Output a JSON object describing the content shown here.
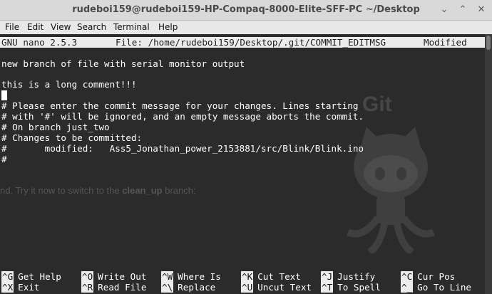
{
  "window": {
    "title": "rudeboi159@rudeboi159-HP-Compaq-8000-Elite-SFF-PC ~/Desktop",
    "controls": [
      "minimize-icon",
      "maximize-icon",
      "close-icon"
    ]
  },
  "menubar": {
    "items": [
      "File",
      "Edit",
      "View",
      "Search",
      "Terminal",
      "Help"
    ]
  },
  "nano": {
    "version": "GNU nano 2.5.3",
    "file": "File: /home/rudeboi159/Desktop/.git/COMMIT_EDITMSG",
    "status": "Modified"
  },
  "editor": {
    "lines": [
      "new branch of file with serial monitor output",
      "",
      "this is a long comment!!!",
      "",
      "# Please enter the commit message for your changes. Lines starting",
      "# with '#' will be ignored, and an empty message aborts the commit.",
      "# On branch just_two",
      "# Changes to be committed:",
      "#       modified:   Ass5_Jonathan_power_2153881/src/Blink/Blink.ino",
      "#"
    ]
  },
  "background": {
    "git_text": "Git",
    "note_prefix": "nd. Try it now to switch to the ",
    "note_bold": "clean_up",
    "note_suffix": " branch:"
  },
  "shortcuts": {
    "row1": [
      {
        "key": "^G",
        "label": "Get Help"
      },
      {
        "key": "^O",
        "label": "Write Out"
      },
      {
        "key": "^W",
        "label": "Where Is"
      },
      {
        "key": "^K",
        "label": "Cut Text"
      },
      {
        "key": "^J",
        "label": "Justify"
      },
      {
        "key": "^C",
        "label": "Cur Pos"
      }
    ],
    "row2": [
      {
        "key": "^X",
        "label": "Exit"
      },
      {
        "key": "^R",
        "label": "Read File"
      },
      {
        "key": "^\\",
        "label": "Replace"
      },
      {
        "key": "^U",
        "label": "Uncut Text"
      },
      {
        "key": "^T",
        "label": "To Spell"
      },
      {
        "key": "^_",
        "label": "Go To Line"
      }
    ]
  },
  "colors": {
    "terminal_bg": "#2b2b2b",
    "terminal_fg": "#ffffff",
    "titlebar_bg": "#d9d9d9",
    "menubar_bg": "#e8e8e8",
    "inverse_bg": "#ececec"
  }
}
